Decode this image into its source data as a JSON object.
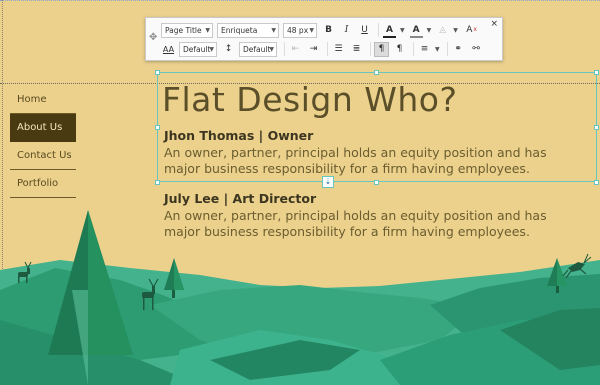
{
  "nav": {
    "items": [
      {
        "label": "Home",
        "active": false
      },
      {
        "label": "About Us",
        "active": true
      },
      {
        "label": "Contact Us",
        "active": false
      },
      {
        "label": "Portfolio",
        "active": false
      }
    ]
  },
  "content": {
    "title": "Flat Design Who?",
    "people": [
      {
        "name": "Jhon Thomas | Owner",
        "desc": "An owner, partner, principal holds an equity position and has major business responsibility for a firm having employees."
      },
      {
        "name": "July Lee | Art Director",
        "desc": "An owner, partner, principal holds an equity position and has major business responsibility for a firm having employees."
      }
    ]
  },
  "toolbar": {
    "style_select": "Page Title",
    "font_select": "Enriqueta",
    "size_select": "48 px",
    "letter_spacing_select": "Default",
    "line_height_select": "Default",
    "close_glyph": "×",
    "bold_glyph": "B",
    "italic_glyph": "I",
    "underline_glyph": "U",
    "text_color_glyph": "A",
    "highlight_glyph": "A",
    "clear_format_glyph": "A",
    "letter_spacing_glyph": "AA"
  },
  "colors": {
    "background": "#ebd18c",
    "nav_active_bg": "#4a3a12",
    "selection_outline": "#69c5c0",
    "tree_dark": "#1e7a52",
    "hill_mid": "#2fa07a",
    "hill_light": "#3aae89"
  },
  "icons": [
    "drag-grip-icon",
    "close-icon",
    "bold-icon",
    "italic-icon",
    "underline-icon",
    "text-color-icon",
    "highlight-icon",
    "opacity-icon",
    "clear-format-icon",
    "letter-spacing-icon",
    "line-height-icon",
    "outdent-icon",
    "indent-icon",
    "bullet-list-icon",
    "numbered-list-icon",
    "paragraph-icon",
    "paragraph-rtl-icon",
    "align-icon",
    "link-icon",
    "unlink-icon",
    "anchor-icon",
    "tree-icon",
    "deer-icon"
  ]
}
